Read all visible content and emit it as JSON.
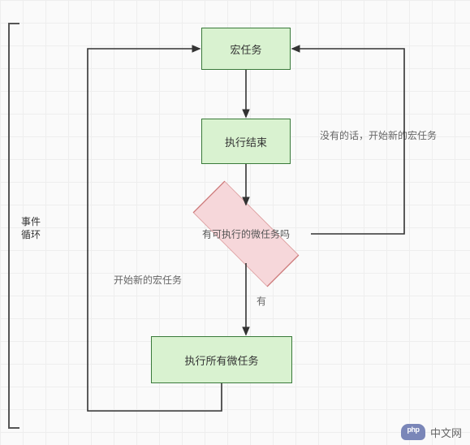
{
  "diagram": {
    "title_label": "事件\n循环",
    "nodes": {
      "macro_task": "宏任务",
      "exec_end": "执行结束",
      "has_micro": "有可执行的微任务吗",
      "exec_micro": "执行所有微任务"
    },
    "edges": {
      "no_label": "没有的话，开始新的宏任务",
      "yes_label": "有",
      "new_macro_label": "开始新的宏任务"
    }
  },
  "watermark": {
    "brand": "php",
    "text": "中文网"
  }
}
